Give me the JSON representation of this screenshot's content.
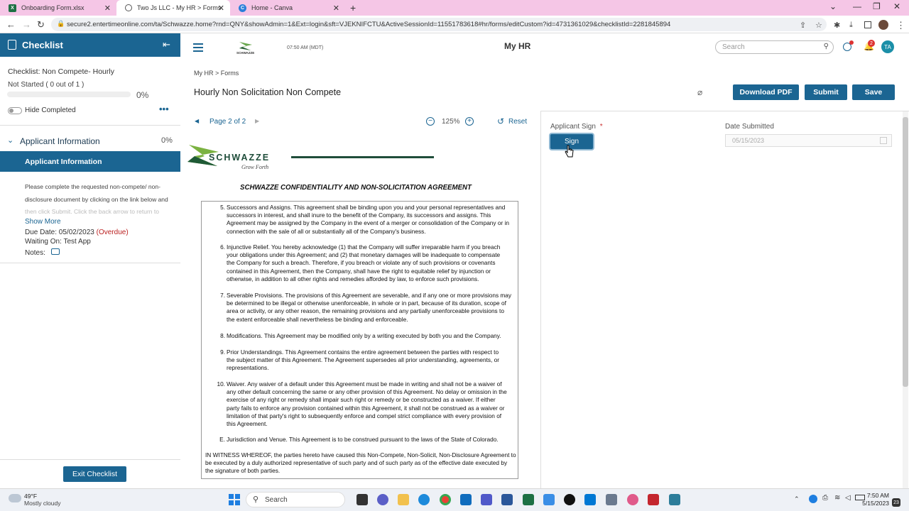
{
  "browser": {
    "tabs": [
      {
        "label": "Onboarding Form.xlsx",
        "fav": "X",
        "color": "#1d7044"
      },
      {
        "label": "Two Js LLC - My HR > Forms",
        "fav": "",
        "color": "#333"
      },
      {
        "label": "Home - Canva",
        "fav": "C",
        "color": "#2b7fd9"
      }
    ],
    "url": "secure2.entertimeonline.com/ta/Schwazze.home?rnd=QNY&showAdmin=1&Ext=login&sft=VJEKNIFCTU&ActiveSessionId=11551783618#hr/forms/editCustom?id=4731361029&checklistId=2281845894"
  },
  "checklist": {
    "title": "Checklist",
    "name": "Checklist: Non Compete- Hourly",
    "status": "Not Started ( 0 out of 1 )",
    "percent": "0%",
    "progress": 0,
    "hide_completed": "Hide Completed",
    "section_title": "Applicant Information",
    "section_percent": "0%",
    "selected_item": "Applicant Information",
    "desc_line1": "Please complete the requested non-compete/ non-",
    "desc_line2": "disclosure document by clicking on the link below and",
    "desc_line3": "then click Submit. Click the back arrow to return to",
    "show_more": "Show More",
    "due_label": "Due Date: 05/02/2023",
    "overdue": "(Overdue)",
    "waiting": "Waiting On: Test App",
    "notes": "Notes:",
    "exit": "Exit Checklist"
  },
  "header": {
    "logo": "SCHWAZZE",
    "time": "07:50 AM (MDT)",
    "app_title": "My HR",
    "search_placeholder": "Search",
    "notif_count": "2",
    "avatar": "TA"
  },
  "page": {
    "breadcrumb_1": "My HR",
    "breadcrumb_sep": ">",
    "breadcrumb_2": "Forms",
    "title": "Hourly Non Solicitation Non Compete",
    "download": "Download PDF",
    "submit": "Submit",
    "save": "Save"
  },
  "viewer": {
    "page_label": "Page 2 of 2",
    "zoom": "125%",
    "reset": "Reset"
  },
  "document": {
    "logo": "SCHWAZZE",
    "tagline": "Grow Forth",
    "heading": "SCHWAZZE CONFIDENTIALITY AND NON-SOLICITATION AGREEMENT",
    "items": [
      {
        "n": "5.",
        "lines": [
          "Successors and Assigns. This agreement shall be binding upon you and your personal representatives and",
          "successors in interest, and shall inure to the benefit of the Company, its successors and assigns. This",
          "Agreement may be assigned by the Company in the event of a merger or consolidation of the Company or in",
          "connection with the sale of all or substantially all of the Company's business."
        ]
      },
      {
        "n": "6.",
        "lines": [
          "Injunctive Relief. You hereby acknowledge (1) that the Company will suffer irreparable harm if you breach",
          "your obligations under this Agreement; and (2) that monetary damages will be inadequate to compensate",
          "the Company for such a breach. Therefore, if you breach or violate any of such provisions or covenants",
          "contained in this Agreement, then the Company, shall have the right to equitable relief by injunction or",
          "otherwise, in addition to all other rights and remedies afforded by law, to enforce such provisions."
        ]
      },
      {
        "n": "7.",
        "lines": [
          "Severable Provisions. The provisions of this Agreement are severable, and if any one or more provisions may",
          "be determined to be illegal or otherwise unenforceable, in whole or in part, because of its duration, scope of",
          "area or activity, or any other reason, the remaining provisions and any partially unenforceable provisions to",
          "the extent enforceable shall nevertheless be binding and enforceable."
        ]
      },
      {
        "n": "8.",
        "lines": [
          "Modifications. This Agreement may be modified only by a writing executed by both you and the Company."
        ]
      },
      {
        "n": "9.",
        "lines": [
          "Prior Understandings. This Agreement contains the entire agreement between the parties with respect to",
          "the subject matter of this Agreement. The Agreement supersedes all prior understanding, agreements, or",
          "representations."
        ]
      },
      {
        "n": "10.",
        "lines": [
          "Waiver. Any waiver of a default under this Agreement must be made in writing and shall not be a waiver of",
          "any other default concerning the same or any other provision of this Agreement. No delay or omission in the",
          "exercise of any right or remedy shall impair such right or remedy or be constructed as a waiver. If either",
          "party fails to enforce any provision contained within this Agreement, it shall not be construed as a waiver or",
          "limitation of that party's right to subsequently enforce and compel strict compliance with every provision of",
          "this Agreement."
        ]
      },
      {
        "n": "E.",
        "lines": [
          "Jurisdiction and Venue. This Agreement is to be construed pursuant to the laws of the State of Colorado."
        ]
      }
    ],
    "witness_lines": [
      "IN WITNESS WHEREOF, the parties hereto have caused this Non-Compete, Non-Solicit, Non-Disclosure Agreement to",
      "be executed by a duly authorized representative of such party and of such party as of the effective date executed by",
      "the signature of both parties."
    ]
  },
  "form": {
    "sign_label": "Applicant Sign",
    "required": "*",
    "sign_button": "Sign",
    "date_label": "Date Submitted",
    "date_value": "05/15/2023"
  },
  "taskbar": {
    "weather_temp": "49°F",
    "weather_desc": "Mostly cloudy",
    "search": "Search",
    "time": "7:50 AM",
    "date": "5/15/2023",
    "badge": "23"
  }
}
